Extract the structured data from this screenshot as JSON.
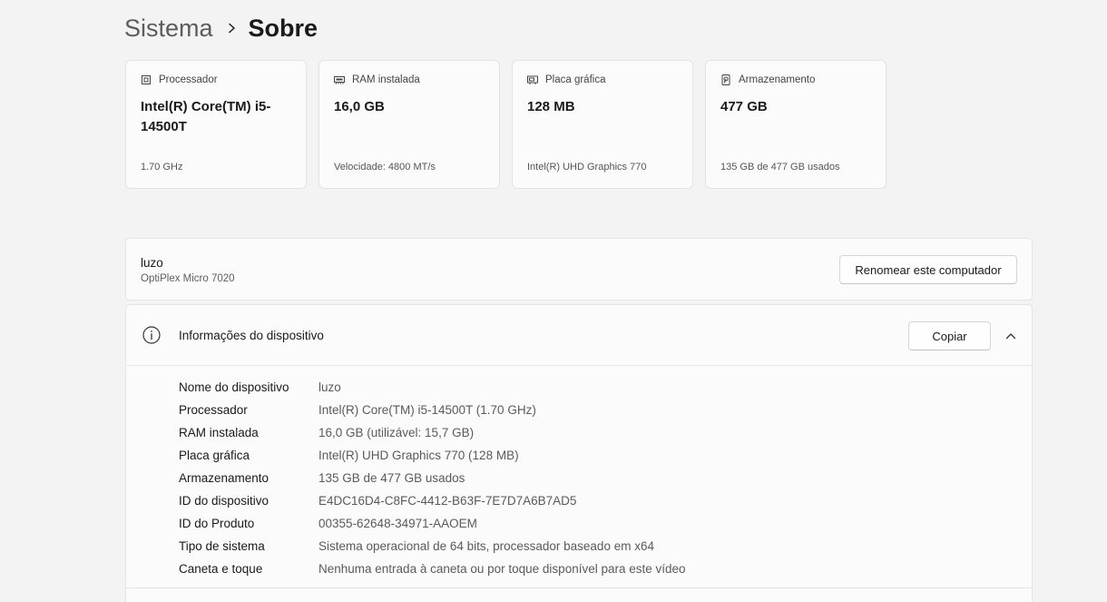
{
  "breadcrumb": {
    "parent": "Sistema",
    "current": "Sobre"
  },
  "spec_cards": [
    {
      "icon": "processor-icon",
      "label": "Processador",
      "value": "Intel(R) Core(TM) i5-14500T",
      "sub": "1.70 GHz"
    },
    {
      "icon": "ram-icon",
      "label": "RAM instalada",
      "value": "16,0 GB",
      "sub": "Velocidade: 4800 MT/s"
    },
    {
      "icon": "graphics-card-icon",
      "label": "Placa gráfica",
      "value": "128 MB",
      "sub": "Intel(R) UHD Graphics 770"
    },
    {
      "icon": "storage-icon",
      "label": "Armazenamento",
      "value": "477 GB",
      "sub": "135 GB de 477 GB usados"
    }
  ],
  "computer": {
    "name": "luzo",
    "model": "OptiPlex Micro 7020",
    "rename_label": "Renomear este computador"
  },
  "device_info": {
    "title": "Informações do dispositivo",
    "copy_label": "Copiar",
    "rows": [
      {
        "key": "Nome do dispositivo",
        "value": "luzo"
      },
      {
        "key": "Processador",
        "value": "Intel(R) Core(TM) i5-14500T (1.70 GHz)"
      },
      {
        "key": "RAM instalada",
        "value": "16,0 GB (utilizável: 15,7 GB)"
      },
      {
        "key": "Placa gráfica",
        "value": "Intel(R) UHD Graphics 770 (128 MB)"
      },
      {
        "key": "Armazenamento",
        "value": "135 GB de 477 GB usados"
      },
      {
        "key": "ID do dispositivo",
        "value": "E4DC16D4-C8FC-4412-B63F-7E7D7A6B7AD5"
      },
      {
        "key": "ID do Produto",
        "value": "00355-62648-34971-AAOEM"
      },
      {
        "key": "Tipo de sistema",
        "value": "Sistema operacional de 64 bits, processador baseado em x64"
      },
      {
        "key": "Caneta e toque",
        "value": "Nenhuma entrada à caneta ou por toque disponível para este vídeo"
      }
    ]
  }
}
